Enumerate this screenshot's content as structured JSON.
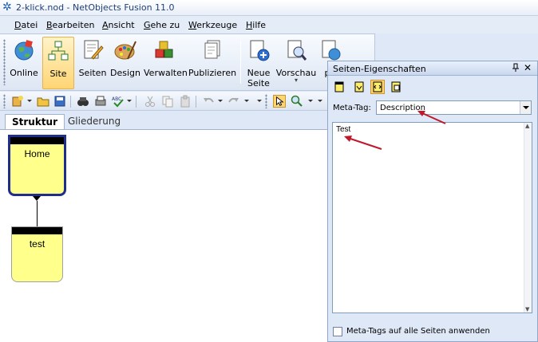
{
  "window": {
    "title": "2-klick.nod - NetObjects Fusion 11.0"
  },
  "menu": [
    {
      "pre": "",
      "u": "D",
      "post": "atei"
    },
    {
      "pre": "",
      "u": "B",
      "post": "earbeiten"
    },
    {
      "pre": "",
      "u": "A",
      "post": "nsicht"
    },
    {
      "pre": "",
      "u": "G",
      "post": "ehe zu"
    },
    {
      "pre": "",
      "u": "W",
      "post": "erkzeuge"
    },
    {
      "pre": "",
      "u": "H",
      "post": "ilfe"
    }
  ],
  "toolbar": {
    "online": "Online",
    "site": "Site",
    "seiten": "Seiten",
    "design": "Design",
    "verwalten": "Verwalten",
    "publizieren": "Publizieren",
    "neue_seite_1": "Neue",
    "neue_seite_2": "Seite",
    "vorschau": "Vorschau",
    "partial": "p"
  },
  "tabs": {
    "struktur": "Struktur",
    "gliederung": "Gliederung"
  },
  "pages": {
    "home": "Home",
    "test": "test"
  },
  "panel": {
    "title": "Seiten-Eigenschaften",
    "pin": "ꟼ",
    "meta_label": "Meta-Tag:",
    "meta_value": "Description",
    "text": "Test",
    "checkbox_label": "Meta-Tags auf alle Seiten anwenden"
  },
  "colors": {
    "accent": "#1f2e8a",
    "page": "#ffff8c",
    "annotation": "#c0182a"
  }
}
